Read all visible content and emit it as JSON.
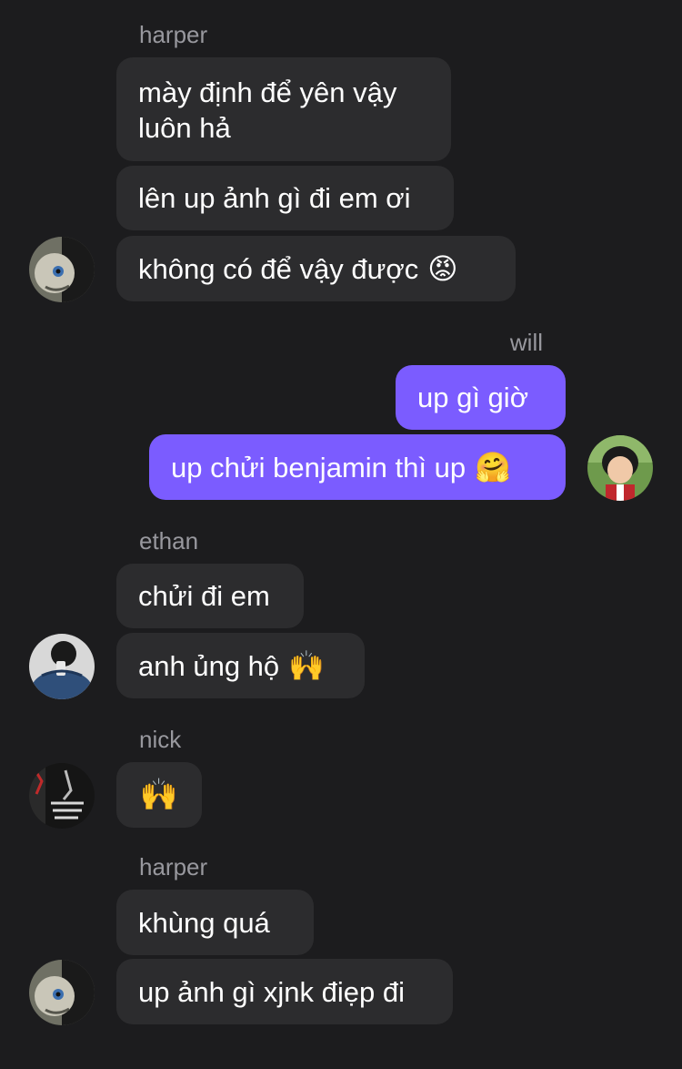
{
  "groups": [
    {
      "sender": "harper",
      "messages": [
        "mày định để yên vậy luôn hả",
        "lên up ảnh gì đi em ơi",
        "không có để vậy được"
      ],
      "emoji_3": "😡",
      "avatar_icon": "harper-avatar-icon"
    },
    {
      "sender": "will",
      "messages": [
        "up gì giờ",
        "up chửi benjamin thì up"
      ],
      "emoji_2": "🤗",
      "avatar_icon": "will-avatar-icon"
    },
    {
      "sender": "ethan",
      "messages": [
        "chửi đi em",
        "anh ủng hộ"
      ],
      "emoji_2": "🙌",
      "avatar_icon": "ethan-avatar-icon"
    },
    {
      "sender": "nick",
      "messages": [
        "🙌"
      ],
      "avatar_icon": "nick-avatar-icon"
    },
    {
      "sender": "harper",
      "messages": [
        "khùng quá",
        "up ảnh gì xjnk điẹp đi"
      ],
      "avatar_icon": "harper-avatar-icon"
    }
  ],
  "colors": {
    "background": "#1c1c1e",
    "incoming_bubble": "#2c2c2e",
    "outgoing_bubble": "#7b5cff",
    "sender_name": "#98989e"
  }
}
